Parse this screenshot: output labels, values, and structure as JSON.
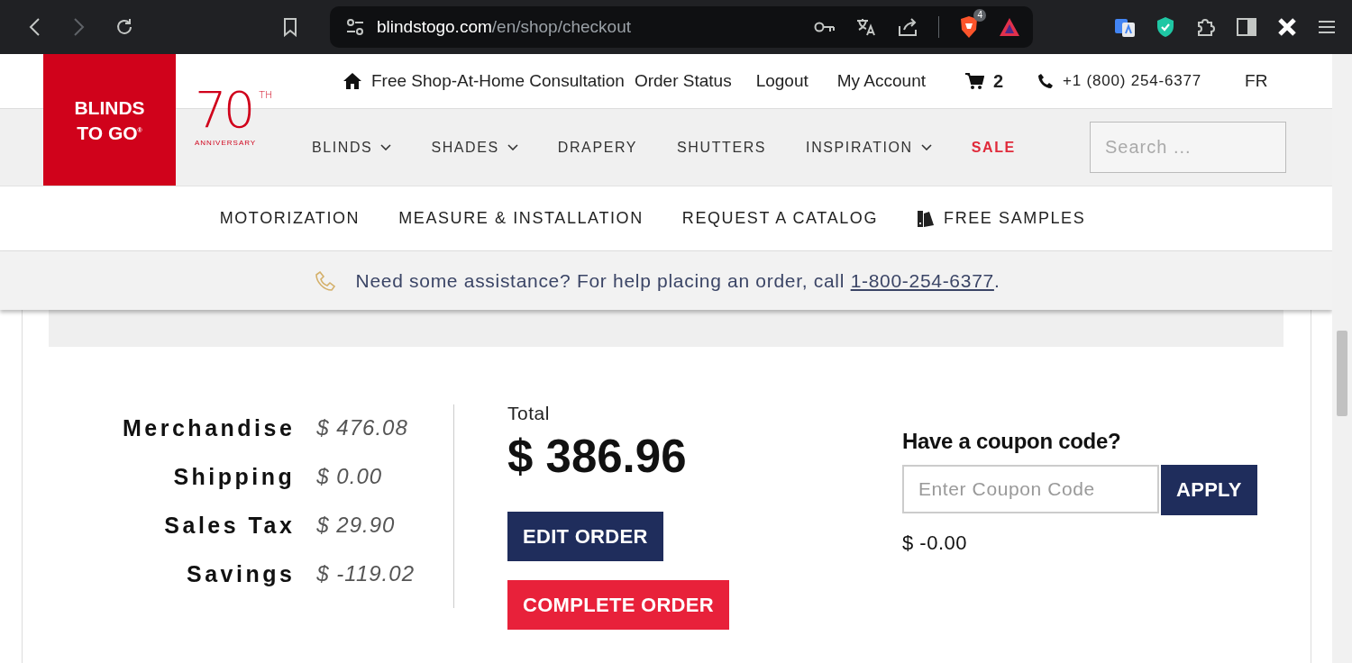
{
  "browser": {
    "url_host": "blindstogo.com",
    "url_path": "/en/shop/checkout",
    "extension_badge": "4"
  },
  "header": {
    "logo": {
      "line1": "BLINDS",
      "line2": "TO GO",
      "line2_mark": "®",
      "anniversary_number": "70",
      "anniversary_suffix": "TH",
      "anniversary_label": "ANNIVERSARY"
    },
    "top_links": [
      {
        "kind": "home",
        "label": "Free Shop-At-Home Consultation"
      },
      {
        "kind": "link",
        "label": "Order Status"
      },
      {
        "kind": "link",
        "label": "Logout"
      },
      {
        "kind": "link",
        "label": "My Account"
      },
      {
        "kind": "cart",
        "label": "2"
      },
      {
        "kind": "phone",
        "label": "+1 (800) 254-6377"
      },
      {
        "kind": "link",
        "label": "FR"
      }
    ],
    "main_nav": [
      {
        "label": "BLINDS",
        "dropdown": true,
        "sale": false
      },
      {
        "label": "SHADES",
        "dropdown": true,
        "sale": false
      },
      {
        "label": "DRAPERY",
        "dropdown": false,
        "sale": false
      },
      {
        "label": "SHUTTERS",
        "dropdown": false,
        "sale": false
      },
      {
        "label": "INSPIRATION",
        "dropdown": true,
        "sale": false
      },
      {
        "label": "SALE",
        "dropdown": false,
        "sale": true
      }
    ],
    "search": {
      "placeholder": "Search ..."
    },
    "sub_nav": [
      {
        "kind": "link",
        "label": "MOTORIZATION"
      },
      {
        "kind": "link",
        "label": "MEASURE & INSTALLATION"
      },
      {
        "kind": "link",
        "label": "REQUEST A CATALOG"
      },
      {
        "kind": "samples",
        "label": "FREE SAMPLES"
      }
    ]
  },
  "help": {
    "text": "Need some assistance? For help placing an order, call ",
    "phone": "1-800-254-6377",
    "end": "."
  },
  "summary": {
    "lines": [
      {
        "label": "Merchandise",
        "value": "$ 476.08"
      },
      {
        "label": "Shipping",
        "value": "$ 0.00"
      },
      {
        "label": "Sales Tax",
        "value": "$ 29.90"
      },
      {
        "label": "Savings",
        "value": "$ -119.02"
      }
    ],
    "total_label": "Total",
    "total": "$ 386.96",
    "buttons": [
      {
        "kind": "edit",
        "label": "EDIT ORDER"
      },
      {
        "kind": "complete",
        "label": "COMPLETE ORDER"
      }
    ],
    "coupon": {
      "title": "Have a coupon code?",
      "placeholder": "Enter Coupon Code",
      "button": "APPLY",
      "discount": "$ -0.00"
    }
  }
}
